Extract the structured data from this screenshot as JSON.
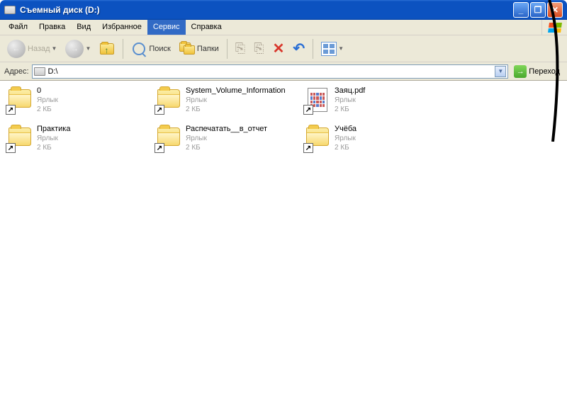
{
  "titlebar": {
    "title": "Съемный диск (D:)"
  },
  "menu": {
    "items": [
      "Файл",
      "Правка",
      "Вид",
      "Избранное",
      "Сервис",
      "Справка"
    ],
    "active_index": 4
  },
  "toolbar": {
    "back_label": "Назад",
    "search_label": "Поиск",
    "folders_label": "Папки"
  },
  "address": {
    "label": "Адрес:",
    "path": "D:\\",
    "go_label": "Переход"
  },
  "files": [
    {
      "name": "0",
      "type": "Ярлык",
      "size": "2 КБ",
      "icon": "folder"
    },
    {
      "name": "System_Volume_Information",
      "type": "Ярлык",
      "size": "2 КБ",
      "icon": "folder"
    },
    {
      "name": "Заяц.pdf",
      "type": "Ярлык",
      "size": "2 КБ",
      "icon": "file"
    },
    {
      "name": "Практика",
      "type": "Ярлык",
      "size": "2 КБ",
      "icon": "folder"
    },
    {
      "name": "Распечатать__в_отчет",
      "type": "Ярлык",
      "size": "2 КБ",
      "icon": "folder"
    },
    {
      "name": "Учёба",
      "type": "Ярлык",
      "size": "2 КБ",
      "icon": "folder"
    }
  ]
}
